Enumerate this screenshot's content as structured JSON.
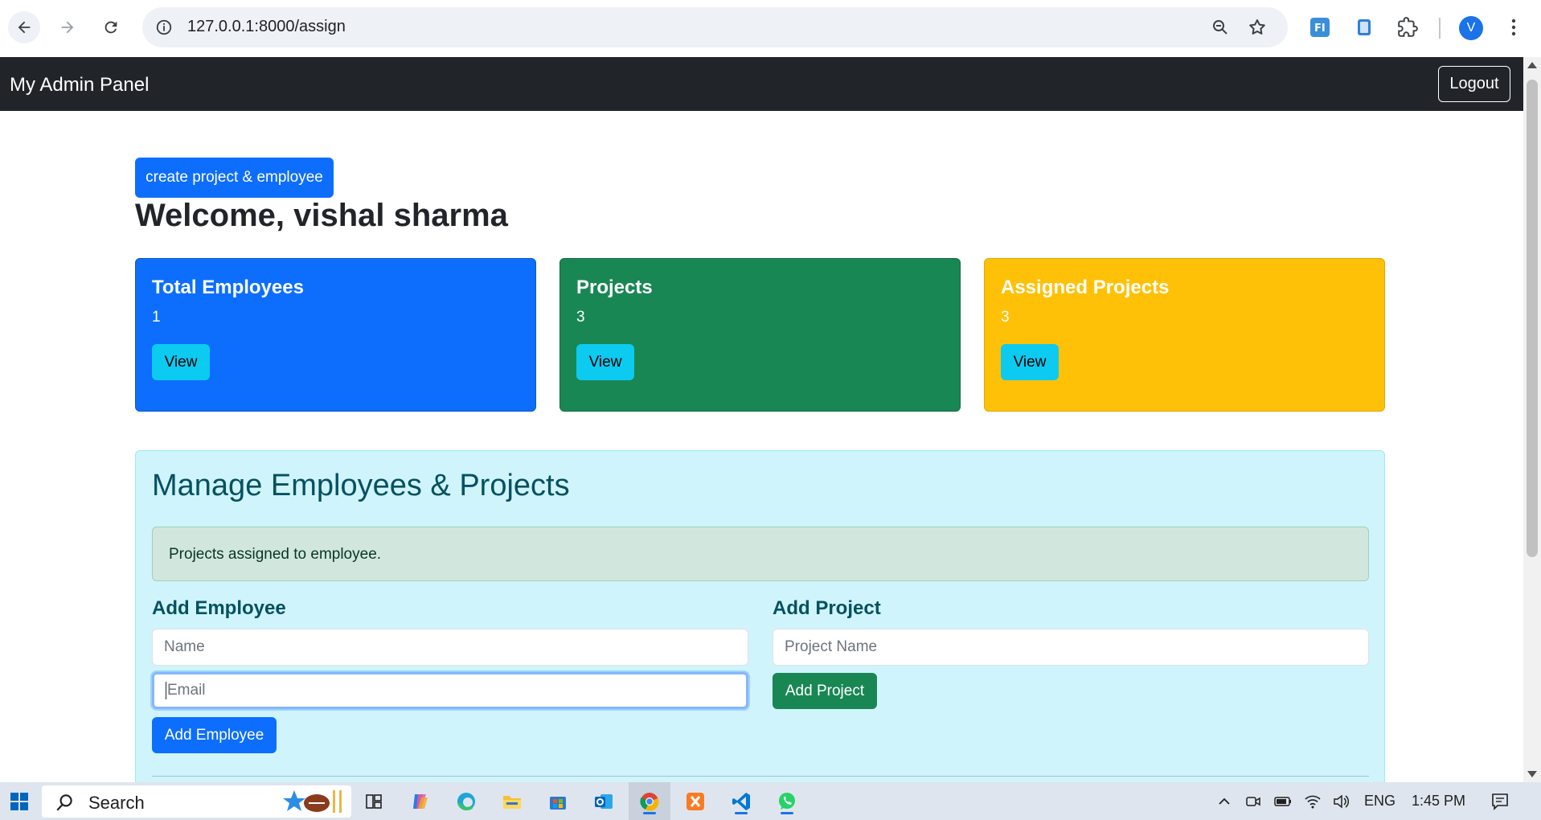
{
  "browser": {
    "url": "127.0.0.1:8000/assign",
    "profile_initial": "V",
    "icons": [
      "back-icon",
      "forward-icon",
      "reload-icon",
      "site-info-icon",
      "zoom-icon",
      "star-icon",
      "extension-fi-icon",
      "extension-phone-icon",
      "puzzle-icon",
      "more-icon"
    ]
  },
  "navbar": {
    "brand": "My Admin Panel",
    "logout_label": "Logout"
  },
  "page": {
    "create_button": "create project & employee",
    "welcome": "Welcome, vishal sharma"
  },
  "cards": [
    {
      "title": "Total Employees",
      "count": "1",
      "button": "View",
      "color": "#0d6efd"
    },
    {
      "title": "Projects",
      "count": "3",
      "button": "View",
      "color": "#198754"
    },
    {
      "title": "Assigned Projects",
      "count": "3",
      "button": "View",
      "color": "#ffc107"
    }
  ],
  "manage": {
    "title": "Manage Employees & Projects",
    "alert": "Projects assigned to employee.",
    "add_employee": {
      "heading": "Add Employee",
      "name_placeholder": "Name",
      "email_placeholder": "Email",
      "button": "Add Employee"
    },
    "add_project": {
      "heading": "Add Project",
      "name_placeholder": "Project Name",
      "button": "Add Project"
    }
  },
  "taskbar": {
    "search_label": "Search",
    "language": "ENG",
    "time": "1:45 PM"
  }
}
